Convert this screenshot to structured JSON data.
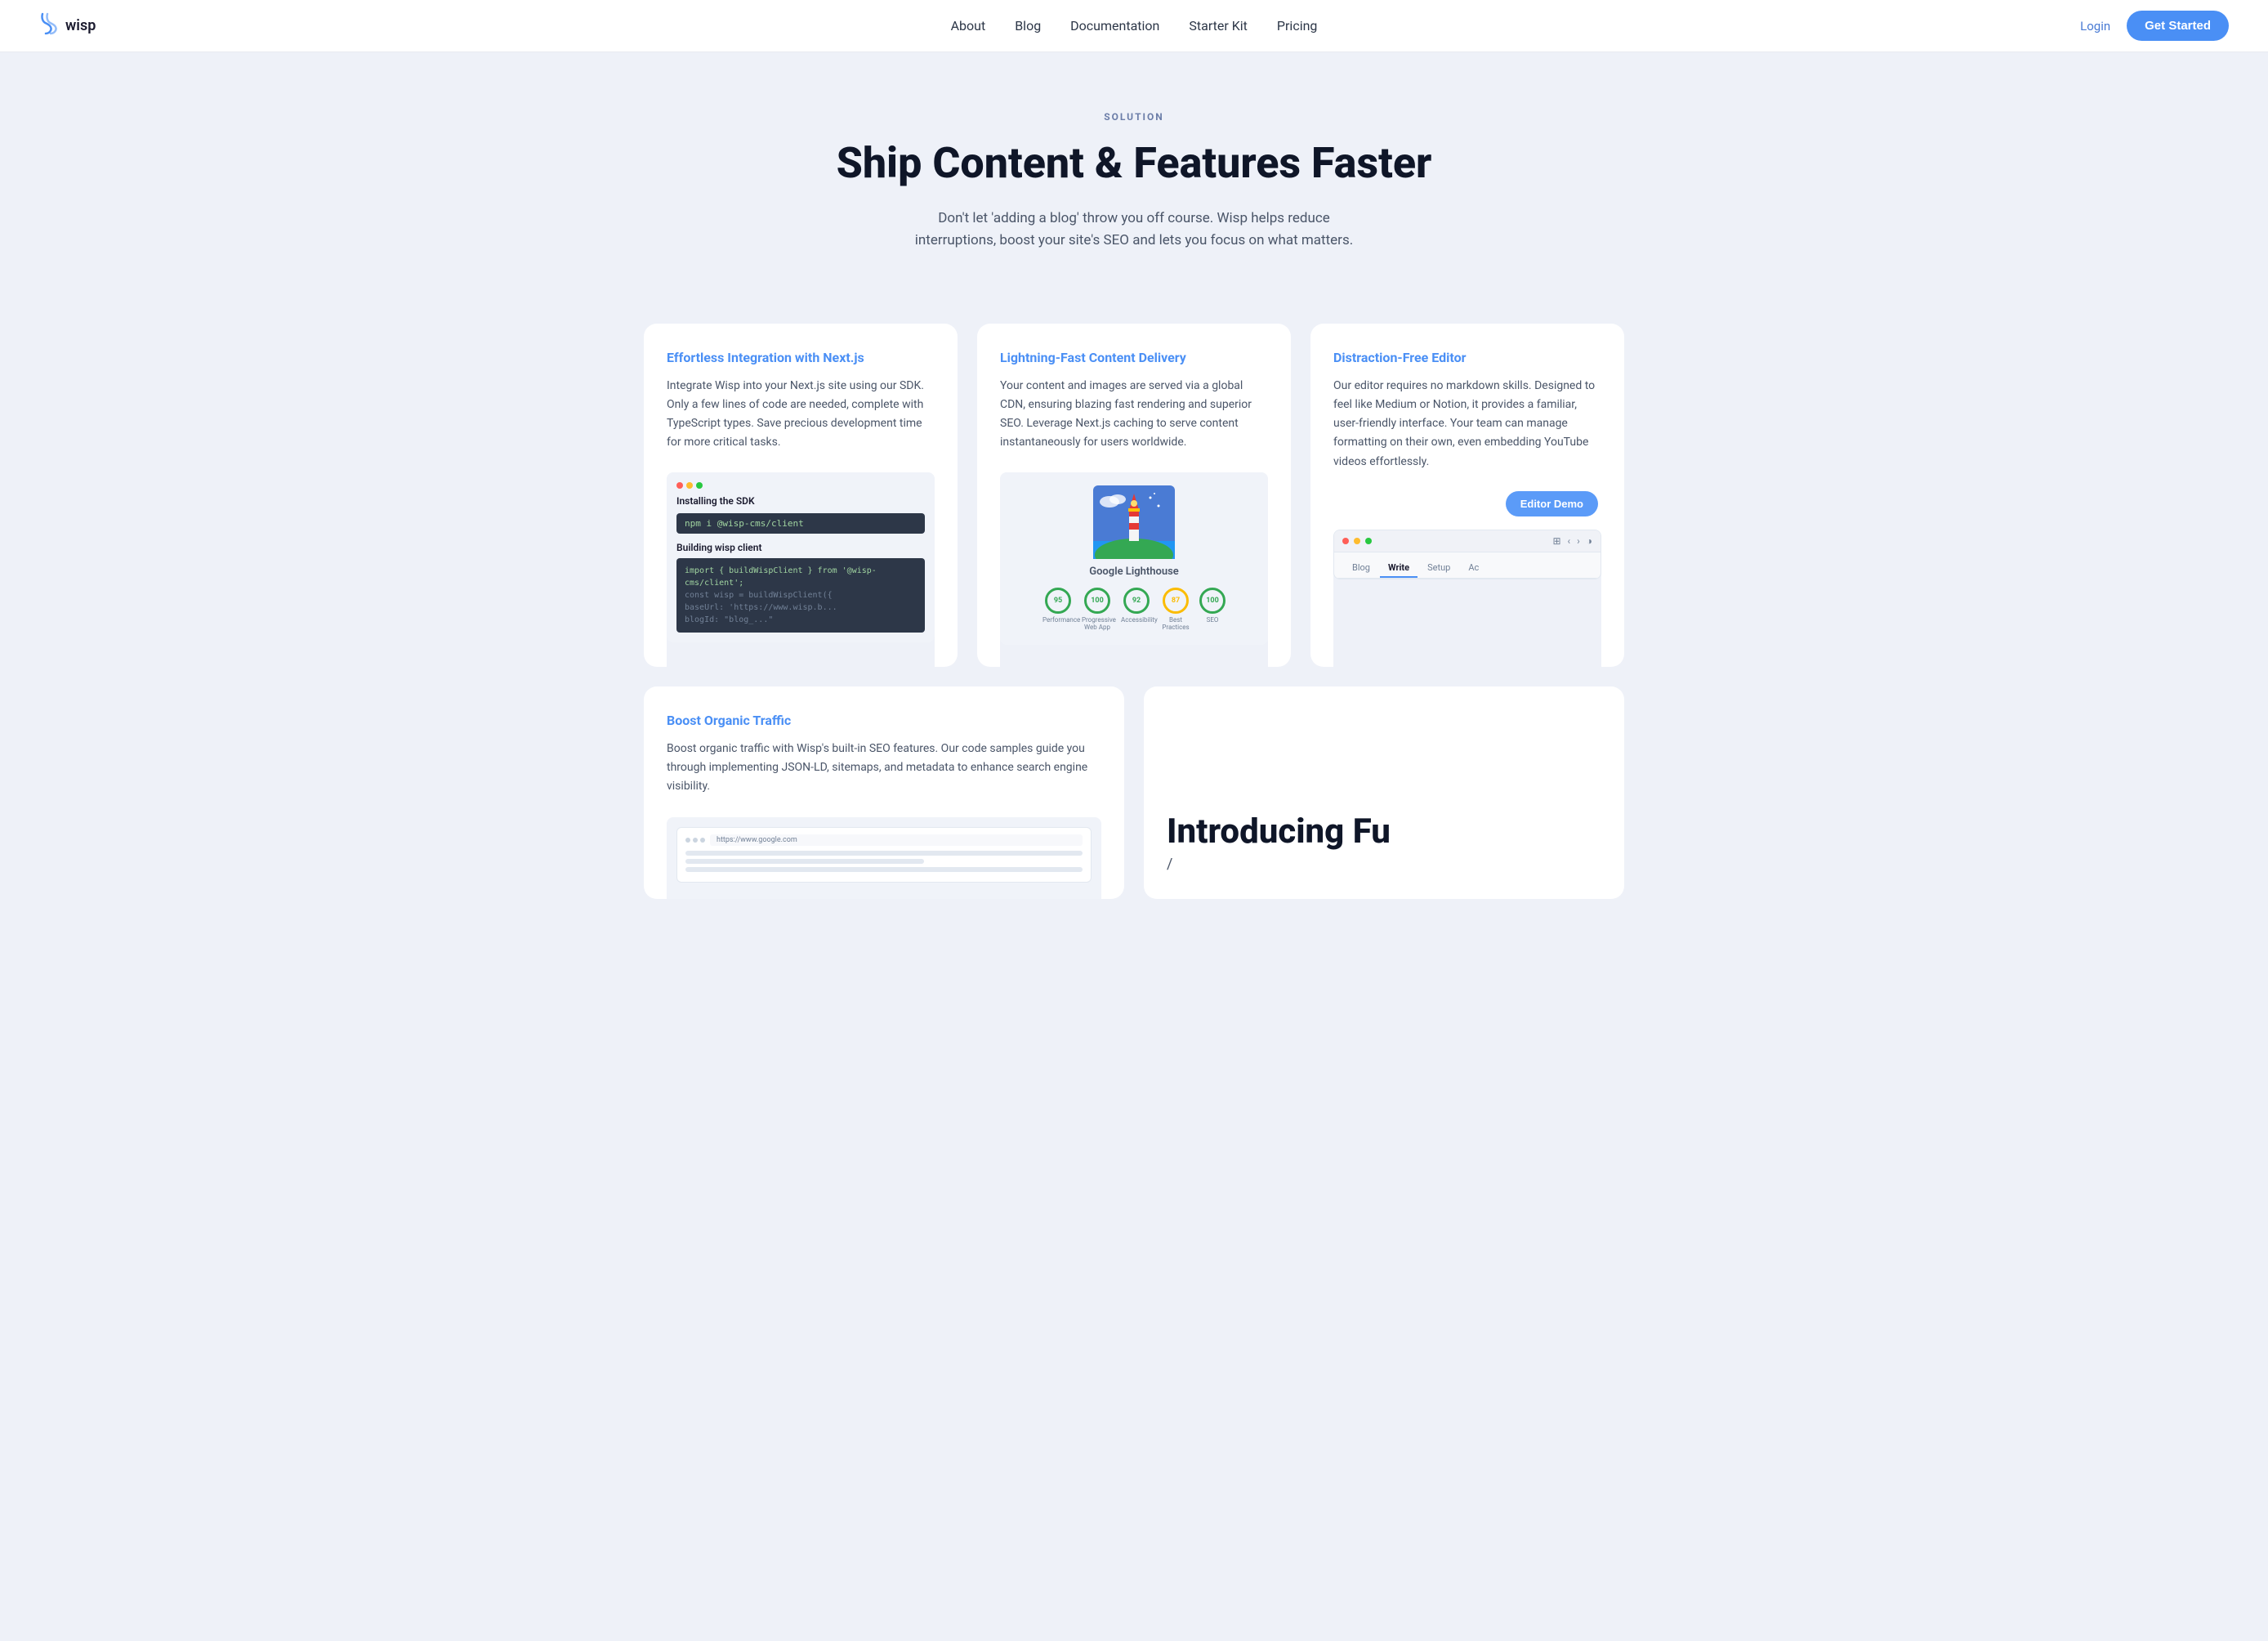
{
  "brand": {
    "name": "wisp",
    "icon": "𝒮"
  },
  "nav": {
    "links": [
      {
        "label": "About",
        "href": "#"
      },
      {
        "label": "Blog",
        "href": "#"
      },
      {
        "label": "Documentation",
        "href": "#"
      },
      {
        "label": "Starter Kit",
        "href": "#"
      },
      {
        "label": "Pricing",
        "href": "#"
      }
    ],
    "login_label": "Login",
    "cta_label": "Get Started"
  },
  "hero": {
    "tag": "SOLUTION",
    "title": "Ship Content & Features Faster",
    "subtitle": "Don't let 'adding a blog' throw you off course. Wisp helps reduce interruptions, boost your site's SEO and lets you focus on what matters."
  },
  "cards": [
    {
      "id": "nextjs",
      "title": "Effortless Integration with Next.js",
      "body": "Integrate Wisp into your Next.js site using our SDK. Only a few lines of code are needed, complete with TypeScript types. Save precious development time for more critical tasks.",
      "mockup_type": "code"
    },
    {
      "id": "cdn",
      "title": "Lightning-Fast Content Delivery",
      "body": "Your content and images are served via a global CDN, ensuring blazing fast rendering and superior SEO. Leverage Next.js caching to serve content instantaneously for users worldwide.",
      "mockup_type": "lighthouse"
    },
    {
      "id": "editor",
      "title": "Distraction-Free Editor",
      "body": "Our editor requires no markdown skills. Designed to feel like Medium or Notion, it provides a familiar, user-friendly interface. Your team can manage formatting on their own, even embedding YouTube videos effortlessly.",
      "mockup_type": "editor"
    }
  ],
  "bottom_cards": [
    {
      "id": "seo",
      "title": "Boost Organic Traffic",
      "body": "Boost organic traffic with Wisp's built-in SEO features. Our code samples guide you through implementing JSON-LD, sitemaps, and metadata to enhance search engine visibility.",
      "mockup_type": "browser"
    },
    {
      "id": "introducing",
      "big_text": "Introducing Fu",
      "sub_text": "/"
    }
  ],
  "code_mockup": {
    "cmd_text": "npm i @wisp-cms/client",
    "section1": "Installing the SDK",
    "section2": "Building wisp client",
    "lines": [
      "import { buildWispClient } from '@wisp-cms/client';",
      "const wisp = buildWispClient({",
      "  baseUrl: 'https://www.wisp.b...",
      "  blogId: \"blog_...\""
    ]
  },
  "lighthouse_scores": [
    {
      "value": "95",
      "label": "Performance",
      "color": "green"
    },
    {
      "value": "100",
      "label": "Progressive Web App",
      "color": "green"
    },
    {
      "value": "92",
      "label": "Accessibility",
      "color": "green"
    },
    {
      "value": "87",
      "label": "Best Practices",
      "color": "orange"
    },
    {
      "value": "100",
      "label": "SEO",
      "color": "green"
    }
  ],
  "editor_tabs": [
    {
      "label": "Blog",
      "active": false
    },
    {
      "label": "Write",
      "active": true
    },
    {
      "label": "Setup",
      "active": false
    },
    {
      "label": "Ac",
      "active": false
    }
  ],
  "editor_demo_btn": "Editor Demo"
}
